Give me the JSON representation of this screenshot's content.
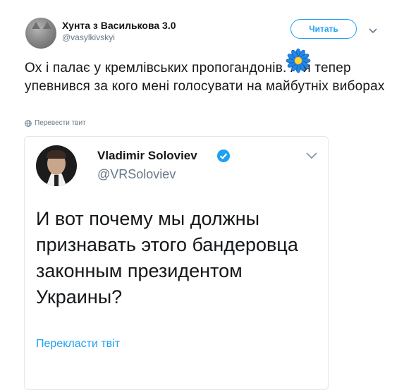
{
  "author": {
    "display_name": "Хунта з Василькова 3.0",
    "handle": "@vasylkivskyi"
  },
  "follow_button": {
    "label": "Читать"
  },
  "tweet": {
    "text": "Ох і палає у кремлівських пропогандонів. А я тепер упевнився за кого мені голосувати на майбутніх виборах",
    "translate_label": "Перевести твит"
  },
  "embedded": {
    "display_name": "Vladimir Soloviev",
    "handle": "@VRSoloviev",
    "text": "И вот почему мы должны признавать этого бандеровца законным президентом Украины?",
    "translate_label": "Перекласти твіт"
  },
  "colors": {
    "accent": "#1da1f2",
    "secondary_text": "#657786",
    "flower_petals": "#1e88e5",
    "flower_center": "#fdd835"
  },
  "icons": [
    "chevron-down-icon",
    "globe-icon",
    "verified-badge-icon",
    "flower-icon"
  ]
}
